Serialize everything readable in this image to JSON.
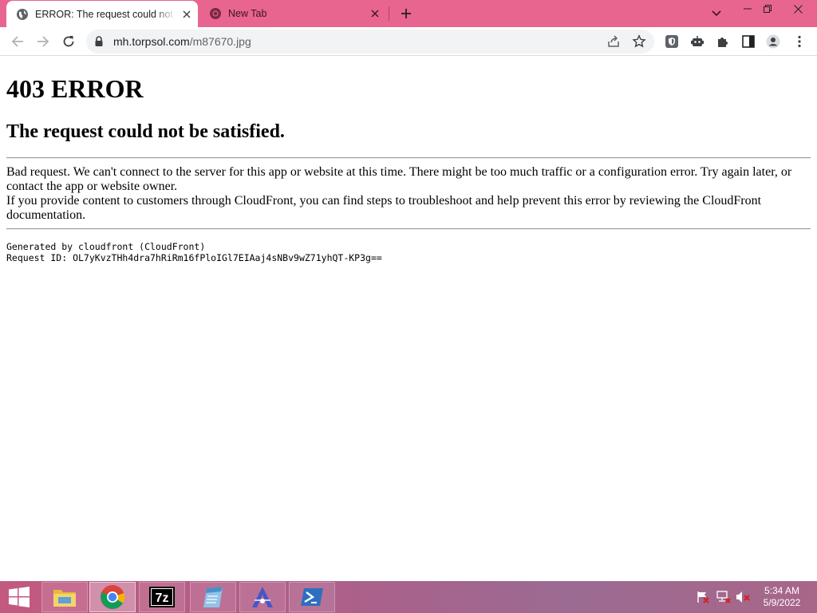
{
  "browser": {
    "tabs": [
      {
        "title": "ERROR: The request could not be satisfied",
        "active": true
      },
      {
        "title": "New Tab",
        "active": false
      }
    ],
    "url": {
      "host": "mh.torpsol.com",
      "path": "/m87670.jpg"
    },
    "icons": {
      "back": "arrow-left-icon",
      "forward": "arrow-right-icon",
      "reload": "reload-icon",
      "lock": "lock-icon",
      "share": "share-icon",
      "bookmark": "star-icon",
      "extensions": [
        "shield-extension-icon",
        "robot-extension-icon",
        "puzzle-icon"
      ],
      "side_panel": "side-panel-icon",
      "profile": "profile-icon",
      "menu": "kebab-menu-icon"
    },
    "colors": {
      "tabstrip": "#e8658f",
      "omnibox": "#f1f3f4"
    }
  },
  "page": {
    "heading": "403 ERROR",
    "subheading": "The request could not be satisfied.",
    "paragraph_1": "Bad request. We can't connect to the server for this app or website at this time. There might be too much traffic or a configuration error. Try again later, or contact the app or website owner.",
    "paragraph_2": "If you provide content to customers through CloudFront, you can find steps to troubleshoot and help prevent this error by reviewing the CloudFront documentation.",
    "generated_by": "Generated by cloudfront (CloudFront)",
    "request_id": "Request ID: OL7yKvzTHh4dra7hRiRm16fPloIGl7EIAaj4sNBv9wZ71yhQT-KP3g=="
  },
  "taskbar": {
    "apps": [
      "start-icon",
      "file-explorer-icon",
      "chrome-icon",
      "7zip-icon",
      "notepad-icon",
      "app-a-icon",
      "powershell-icon"
    ],
    "tray": [
      "flag-icon",
      "network-icon",
      "volume-muted-icon"
    ],
    "time": "5:34 AM",
    "date": "5/9/2022"
  }
}
